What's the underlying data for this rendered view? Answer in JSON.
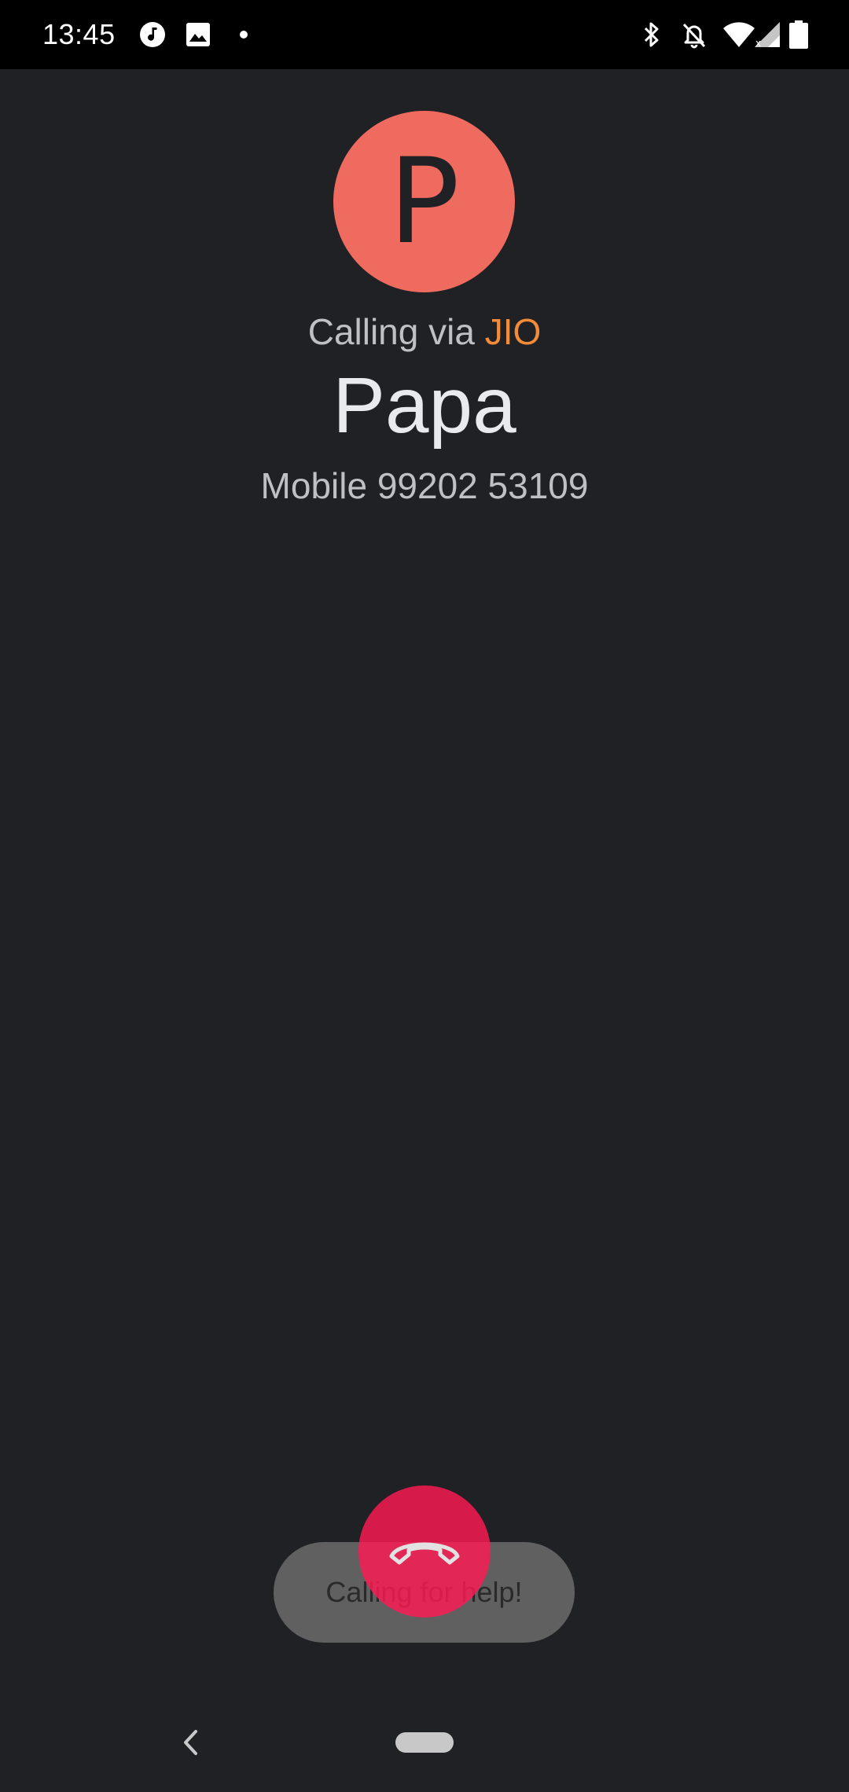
{
  "status_bar": {
    "time": "13:45",
    "left_icons": [
      "music-note-icon",
      "image-icon",
      "notification-dot-icon"
    ],
    "right_icons": [
      "bluetooth-icon",
      "notifications-off-icon",
      "wifi-icon",
      "cell-signal-icon",
      "battery-icon"
    ],
    "battery_level": "81"
  },
  "call": {
    "avatar_letter": "P",
    "calling_via_prefix": "Calling via ",
    "carrier": "JIO",
    "contact_name": "Papa",
    "contact_number": "Mobile 99202 53109"
  },
  "toast": {
    "message": "Calling for help!"
  },
  "colors": {
    "background": "#202124",
    "avatar": "#ef6a5f",
    "carrier_accent": "#f28b3a",
    "end_call": "#ff1a54"
  },
  "navigation": {
    "back_icon": "back-chevron-icon",
    "home_icon": "home-pill-icon"
  }
}
